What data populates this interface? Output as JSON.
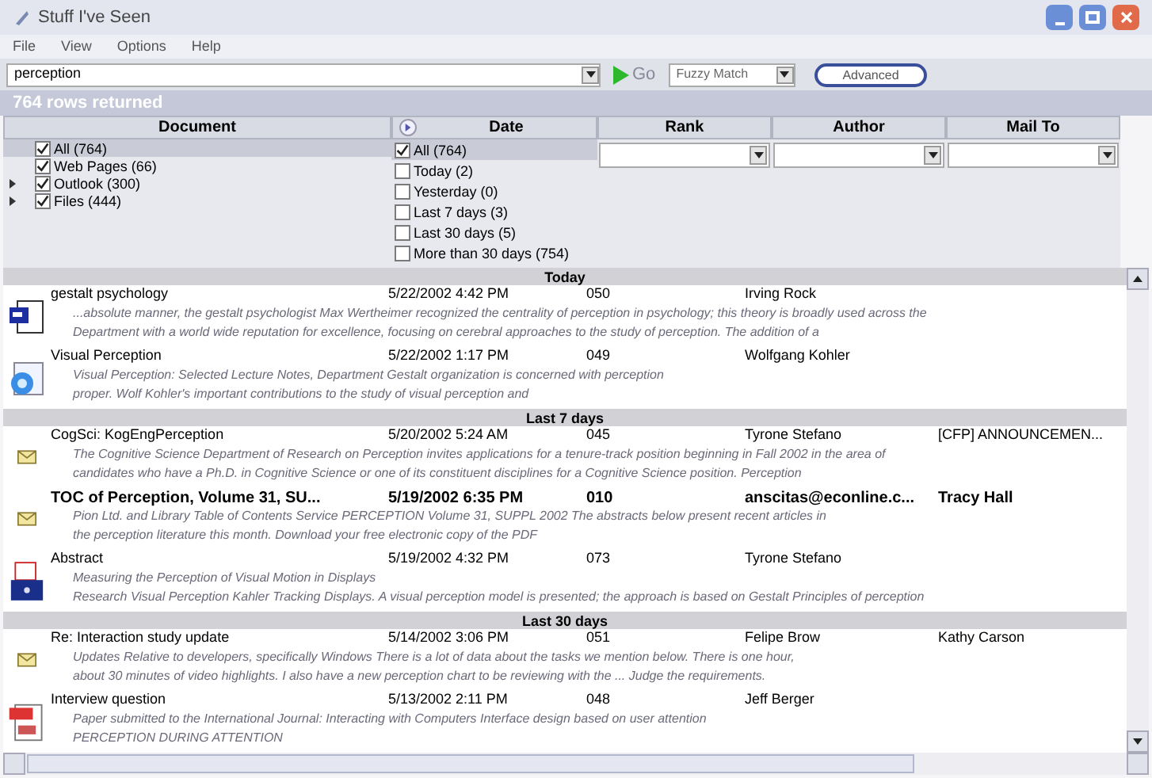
{
  "window": {
    "title": "Stuff I've Seen"
  },
  "menu": [
    "File",
    "View",
    "Options",
    "Help"
  ],
  "search": {
    "value": "perception",
    "go": "Go",
    "match": "Fuzzy Match",
    "advanced": "Advanced"
  },
  "status": "764 rows returned",
  "filters": {
    "document": {
      "header": "Document",
      "items": [
        {
          "label": "All (764)",
          "checked": true,
          "selected": true,
          "expandable": false
        },
        {
          "label": "Web Pages (66)",
          "checked": true,
          "selected": false,
          "expandable": false
        },
        {
          "label": "Outlook (300)",
          "checked": true,
          "selected": false,
          "expandable": true
        },
        {
          "label": "Files (444)",
          "checked": true,
          "selected": false,
          "expandable": true
        }
      ]
    },
    "date": {
      "header": "Date",
      "items": [
        {
          "label": "All (764)",
          "checked": true,
          "selected": true
        },
        {
          "label": "Today (2)",
          "checked": false,
          "selected": false
        },
        {
          "label": "Yesterday (0)",
          "checked": false,
          "selected": false
        },
        {
          "label": "Last 7 days (3)",
          "checked": false,
          "selected": false
        },
        {
          "label": "Last 30 days (5)",
          "checked": false,
          "selected": false
        },
        {
          "label": "More than 30 days (754)",
          "checked": false,
          "selected": false
        }
      ]
    },
    "dropdowns": [
      "Rank",
      "Author",
      "Mail To"
    ]
  },
  "groups": [
    {
      "title": "Today",
      "rows": [
        {
          "kind": "doc",
          "title": "gestalt psychology",
          "date": "5/22/2002 4:42 PM",
          "rank": "050",
          "author": "Irving Rock",
          "mail_to": "",
          "unread": false,
          "snippet": [
            "...absolute manner, the gestalt psychologist Max Wertheimer recognized the centrality of perception in psychology; this theory is broadly used across the",
            "Department with a world wide reputation for excellence, focusing on cerebral approaches to the study of perception. The addition of a"
          ]
        },
        {
          "kind": "web",
          "title": "Visual Perception",
          "date": "5/22/2002 1:17 PM",
          "rank": "049",
          "author": "Wolfgang Kohler",
          "mail_to": "",
          "unread": false,
          "snippet": [
            "Visual      Perception: Selected Lecture Notes, Department    Gestalt organization           is concerned with perception",
            "proper. Wolf      Kohler's important contributions to the study of visual perception           and"
          ]
        }
      ]
    },
    {
      "title": "Last 7 days",
      "rows": [
        {
          "kind": "mail",
          "title": "CogSci: KogEngPerception",
          "date": "5/20/2002 5:24 AM",
          "rank": "045",
          "author": "Tyrone Stefano",
          "mail_to": "[CFP] ANNOUNCEMEN...",
          "unread": false,
          "snippet": [
            "The Cognitive Science Department of Research on Perception invites applications for a tenure-track position beginning in Fall 2002 in the area of",
            "candidates who have a Ph.D. in Cognitive Science or one of its constituent disciplines for a Cognitive Science position. Perception"
          ]
        },
        {
          "kind": "mail",
          "title": "TOC of Perception, Volume 31, SU...",
          "date": "5/19/2002 6:35 PM",
          "rank": "010",
          "author": "anscitas@econline.c...",
          "mail_to": "Tracy Hall",
          "unread": true,
          "snippet": [
            "Pion Ltd. and Library Table of Contents Service    PERCEPTION  Volume 31, SUPPL 2002    The abstracts below present recent articles in",
            "the perception literature this month.    Download your free electronic copy of the PDF"
          ]
        },
        {
          "kind": "flag",
          "title": "Abstract",
          "date": "5/19/2002 4:32 PM",
          "rank": "073",
          "author": "Tyrone Stefano",
          "mail_to": "",
          "unread": false,
          "snippet": [
            "Measuring the Perception of Visual Motion in Displays",
            "Research Visual Perception Kahler Tracking Displays. A visual perception model is presented; the approach is based on Gestalt Principles of perception"
          ]
        }
      ]
    },
    {
      "title": "Last 30 days",
      "rows": [
        {
          "kind": "mail",
          "title": "Re: Interaction study update",
          "date": "5/14/2002 3:06 PM",
          "rank": "051",
          "author": "Felipe Brow",
          "mail_to": "Kathy Carson",
          "unread": false,
          "snippet": [
            "Updates     Relative to developers, specifically Windows     There is a lot of data about the tasks we mention below. There is one hour,",
            "about 30 minutes of video highlights. I also have a new perception chart to be reviewing with the  ... Judge the requirements."
          ]
        },
        {
          "kind": "pdf",
          "title": "Interview question",
          "date": "5/13/2002 2:11 PM",
          "rank": "048",
          "author": "Jeff Berger",
          "mail_to": "",
          "unread": false,
          "snippet": [
            "Paper submitted to the International Journal: Interacting with Computers                                  Interface design based on user attention",
            "PERCEPTION DURING ATTENTION"
          ]
        }
      ]
    }
  ]
}
